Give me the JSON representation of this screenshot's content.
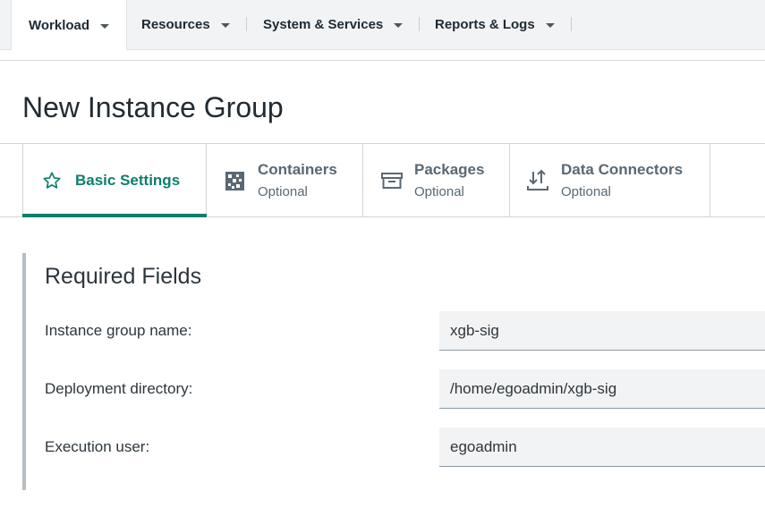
{
  "nav": {
    "items": [
      {
        "label": "Workload"
      },
      {
        "label": "Resources"
      },
      {
        "label": "System & Services"
      },
      {
        "label": "Reports & Logs"
      }
    ]
  },
  "page": {
    "title": "New Instance Group"
  },
  "tabs": [
    {
      "title": "Basic Settings",
      "subtitle": "",
      "icon": "star-icon"
    },
    {
      "title": "Containers",
      "subtitle": "Optional",
      "icon": "grid-icon"
    },
    {
      "title": "Packages",
      "subtitle": "Optional",
      "icon": "package-box-icon"
    },
    {
      "title": "Data Connectors",
      "subtitle": "Optional",
      "icon": "data-transfer-icon"
    }
  ],
  "form": {
    "heading": "Required Fields",
    "fields": [
      {
        "label": "Instance group name:",
        "value": "xgb-sig"
      },
      {
        "label": "Deployment directory:",
        "value": "/home/egoadmin/xgb-sig"
      },
      {
        "label": "Execution user:",
        "value": "egoadmin"
      }
    ]
  },
  "colors": {
    "accent": "#0e7e6a",
    "nav_bg": "#f2f3f4",
    "input_bg": "#f2f3f4"
  }
}
